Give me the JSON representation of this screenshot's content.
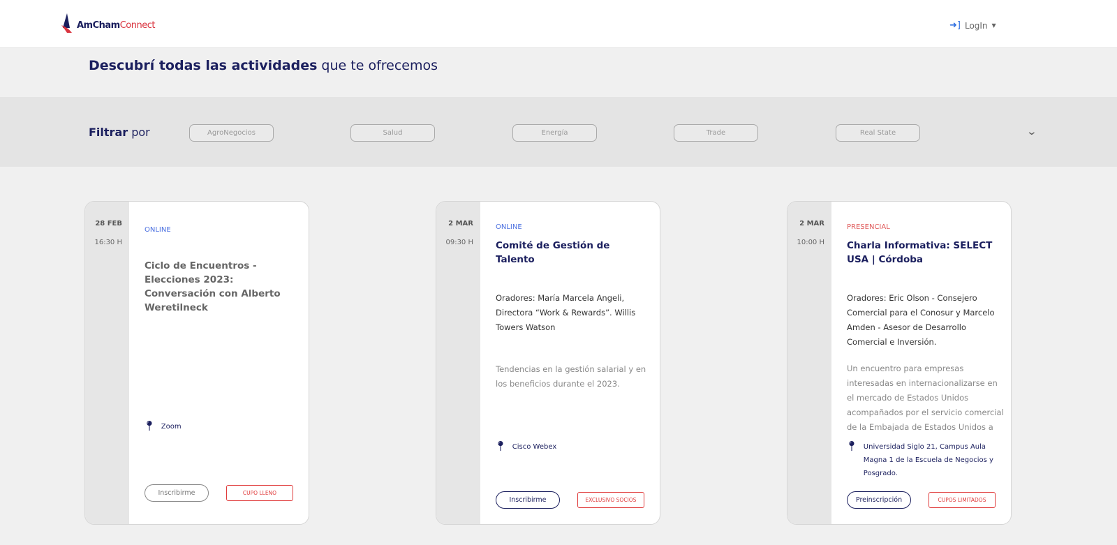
{
  "header": {
    "logo_primary": "AmCham",
    "logo_secondary": "Connect",
    "login_label": "LogIn"
  },
  "page_title": {
    "bold": "Descubrí todas las actividades",
    "rest": " que te ofrecemos"
  },
  "filter": {
    "label_bold": "Filtrar",
    "label_rest": " por",
    "chips": [
      "AgroNegocios",
      "Salud",
      "Energía",
      "Trade",
      "Real State"
    ]
  },
  "cards": [
    {
      "date": "28 FEB",
      "time": "16:30 H",
      "mode": "ONLINE",
      "title": "Ciclo de Encuentros - Elecciones 2023: Conversación con Alberto Weretilneck",
      "speakers": "",
      "description": "",
      "location": "Zoom",
      "button": "Inscribirme",
      "tag": "CUPO LLENO"
    },
    {
      "date": "2 MAR",
      "time": "09:30 H",
      "mode": "ONLINE",
      "title": "Comité de Gestión de Talento",
      "speakers": "Oradores: María Marcela Angeli, Directora “Work & Rewards”. Willis Towers Watson",
      "description": "Tendencias en la gestión salarial y en los beneficios durante el 2023.",
      "location": "Cisco Webex",
      "button": "Inscribirme",
      "tag": "EXCLUSIVO SOCIOS"
    },
    {
      "date": "2 MAR",
      "time": "10:00 H",
      "mode": "PRESENCIAL",
      "title": "Charla Informativa: SELECT USA | Córdoba",
      "speakers": "Oradores: Eric Olson - Consejero Comercial para el Conosur y Marcelo Amden - Asesor de Desarrollo Comercial e Inversión.",
      "description": "Un encuentro para empresas interesadas en internacionalizarse en el mercado de Estados Unidos acompañados por el servicio comercial de la Embajada de Estados Unidos a través de SelectUSA.",
      "location": "Universidad Siglo 21, Campus Aula Magna 1 de la Escuela de Negocios y Posgrado.",
      "button": "Preinscripción",
      "tag": "CUPOS LIMITADOS"
    }
  ],
  "colors": {
    "navy": "#1b1f5e",
    "online": "#4a6fe0",
    "presencial": "#e05a5a",
    "tag_red": "#e03c3c"
  }
}
